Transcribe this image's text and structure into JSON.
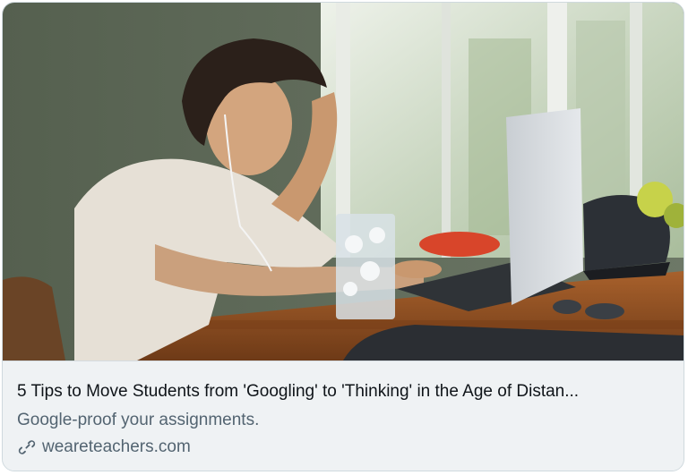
{
  "card": {
    "image_alt": "Boy with earbuds leaning on his hand looking at a laptop at a wooden table",
    "title": "5 Tips to Move Students from 'Googling' to 'Thinking' in the Age of Distan...",
    "description": "Google-proof your assignments.",
    "domain": "weareteachers.com",
    "link_icon": "link-icon"
  },
  "colors": {
    "title": "#0f1419",
    "secondary": "#536471",
    "card_bg": "#eff2f4",
    "border": "#cfd9de"
  }
}
